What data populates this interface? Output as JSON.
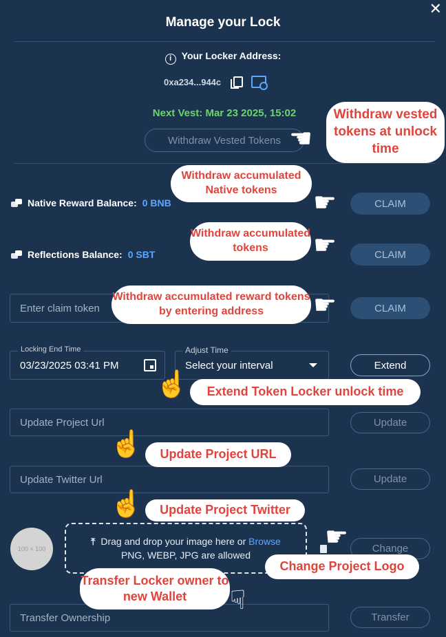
{
  "dialog": {
    "title": "Manage your Lock",
    "close_icon": "close-icon"
  },
  "locker": {
    "address_label": "Your Locker Address:",
    "address": "0xa234...944c",
    "next_vest": "Next Vest: Mar 23 2025, 15:02",
    "withdraw_vested_label": "Withdraw Vested Tokens"
  },
  "balances": {
    "native_label": "Native Reward Balance:",
    "native_value": "0 BNB",
    "reflections_label": "Reflections Balance:",
    "reflections_value": "0 SBT",
    "claim_label": "CLAIM"
  },
  "claim_token": {
    "placeholder": "Enter claim token"
  },
  "lock_time": {
    "label": "Locking End Time",
    "value": "03/23/2025 03:41 PM",
    "adjust_label": "Adjust Time",
    "adjust_value": "Select your interval",
    "extend_label": "Extend"
  },
  "project_url": {
    "placeholder": "Update Project Url",
    "button": "Update"
  },
  "twitter_url": {
    "placeholder": "Update Twitter Url",
    "button": "Update"
  },
  "logo": {
    "avatar_text": "100 × 100",
    "drop_text": "Drag and drop your image here or",
    "browse_text": "Browse",
    "formats_text": "PNG, WEBP, JPG are allowed",
    "change_label": "Change"
  },
  "ownership": {
    "placeholder": "Transfer Ownership",
    "button": "Transfer"
  },
  "callouts": {
    "withdraw_vested": "Withdraw vested tokens at unlock time",
    "withdraw_native": "Withdraw accumulated Native tokens",
    "withdraw_accumulated": "Withdraw accumulated tokens",
    "withdraw_reward_address": "Withdraw accumulated reward tokens by entering address",
    "extend": "Extend Token Locker unlock time",
    "update_url": "Update Project URL",
    "update_twitter": "Update Project Twitter",
    "change_logo": "Change Project Logo",
    "transfer_owner": "Transfer Locker owner to new Wallet"
  },
  "colors": {
    "background": "#1c3350",
    "next_vest_green": "#6ed36e",
    "accent_blue": "#5aa8ff",
    "callout_red": "#e0443c"
  }
}
